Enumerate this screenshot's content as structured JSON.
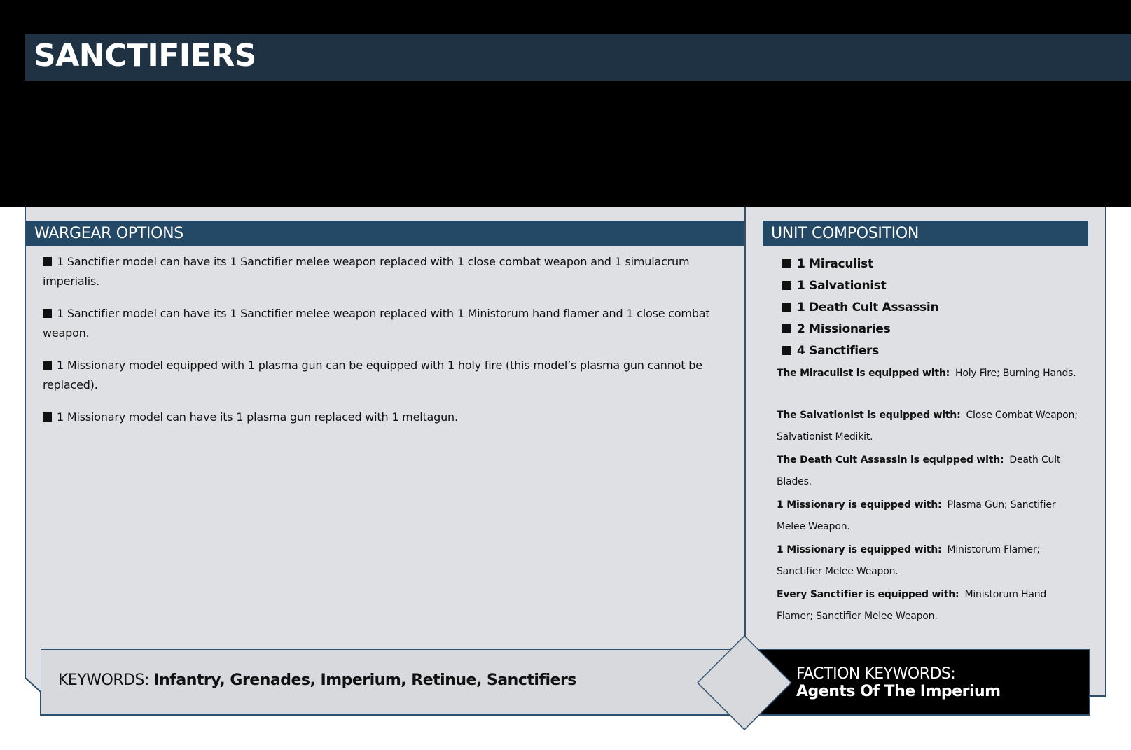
{
  "unit": {
    "title": "SANCTIFIERS"
  },
  "wargear": {
    "header": "WARGEAR OPTIONS",
    "items": [
      "1 Sanctifier model can have its 1 Sanctifier melee weapon replaced with 1 close combat weapon and 1 simulacrum imperialis.",
      "1 Sanctifier model can have its 1 Sanctifier melee weapon replaced with 1 Ministorum hand flamer and 1 close combat weapon.",
      "1 Missionary model equipped with 1 plasma gun can be equipped with 1 holy fire (this model’s plasma gun cannot be replaced).",
      "1 Missionary model can have its 1 plasma gun replaced with 1 meltagun."
    ]
  },
  "composition": {
    "header": "UNIT COMPOSITION",
    "models": [
      "1 Miraculist",
      "1 Salvationist",
      "1 Death Cult Assassin",
      "2 Missionaries",
      "4 Sanctifiers"
    ],
    "equipment": [
      {
        "label": "The Miraculist is equipped with:",
        "value": "Holy Fire; Burning Hands."
      },
      {
        "label": "The Salvationist is equipped with:",
        "value": "Close Combat Weapon; Salvationist Medikit."
      },
      {
        "label": "The Death Cult Assassin is equipped with:",
        "value": "Death Cult Blades."
      },
      {
        "label": "1 Missionary is equipped with:",
        "value": "Plasma Gun; Sanctifier Melee Weapon."
      },
      {
        "label": "1 Missionary is equipped with:",
        "value": "Ministorum Flamer; Sanctifier Melee Weapon."
      },
      {
        "label": "Every Sanctifier is equipped with:",
        "value": "Ministorum Hand Flamer; Sanctifier Melee Weapon."
      }
    ]
  },
  "keywords": {
    "label": "KEYWORDS:",
    "values": "Infantry, Grenades, Imperium, Retinue, Sanctifiers"
  },
  "faction": {
    "label": "FACTION KEYWORDS:",
    "value": "Agents Of The Imperium"
  },
  "colors": {
    "title_bar": "#1e3244",
    "section_header": "#244967",
    "panel": "#dfe0e3",
    "frame_border": "#2f4f6e",
    "keywords_box": "#d8d9dc"
  }
}
